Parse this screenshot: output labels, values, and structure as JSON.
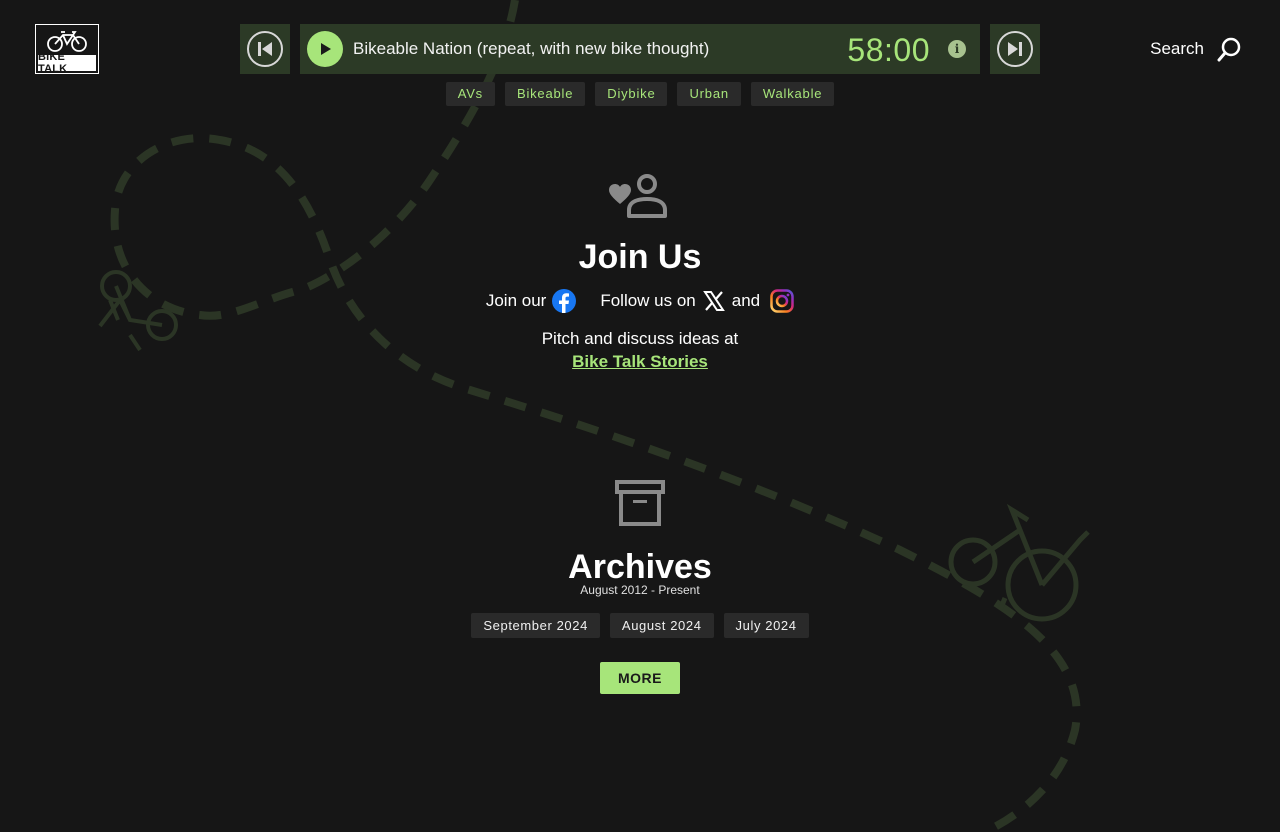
{
  "header": {
    "logo_text": "BIKE TALK",
    "player": {
      "track_title": "Bikeable Nation (repeat, with new bike thought)",
      "time": "58:00",
      "info_icon": "info-icon",
      "prev_icon": "skip-back-icon",
      "next_icon": "skip-forward-icon",
      "play_icon": "play-icon"
    },
    "search_label": "Search"
  },
  "tags": [
    "AVs",
    "Bikeable",
    "Diybike",
    "Urban",
    "Walkable"
  ],
  "join": {
    "title": "Join Us",
    "join_our": "Join our",
    "follow_us_on": "Follow us on",
    "and": "and",
    "pitch": "Pitch and discuss ideas at",
    "link_text": "Bike Talk Stories"
  },
  "archives": {
    "title": "Archives",
    "range": "August 2012 - Present",
    "months": [
      "September 2024",
      "August 2024",
      "July 2024"
    ],
    "more_label": "MORE"
  },
  "colors": {
    "background": "#161616",
    "accent": "#a7e57a",
    "player_bg": "#2c3a26",
    "tag_bg": "#2a2a2a"
  }
}
